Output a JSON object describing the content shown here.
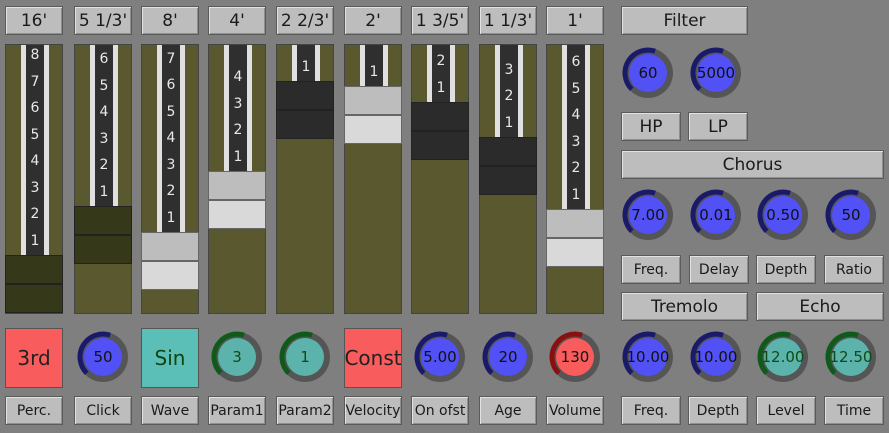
{
  "drawbars": [
    {
      "label": "16'",
      "ticks": [
        "8",
        "7",
        "6",
        "5",
        "4",
        "3",
        "2",
        "1"
      ],
      "handle": "olive",
      "top_seg": "olive"
    },
    {
      "label": "5 1/3'",
      "ticks": [
        "6",
        "5",
        "4",
        "3",
        "2",
        "1"
      ],
      "handle": "olive"
    },
    {
      "label": "8'",
      "ticks": [
        "7",
        "6",
        "5",
        "4",
        "3",
        "2",
        "1"
      ],
      "handle": "light"
    },
    {
      "label": "4'",
      "ticks": [
        "4",
        "3",
        "2",
        "1"
      ],
      "handle": "light"
    },
    {
      "label": "2 2/3'",
      "ticks": [
        "1"
      ],
      "handle": "dark"
    },
    {
      "label": "2'",
      "ticks": [
        "1"
      ],
      "handle": "light"
    },
    {
      "label": "1 3/5'",
      "ticks": [
        "2",
        "1"
      ],
      "handle": "dark"
    },
    {
      "label": "1 1/3'",
      "ticks": [
        "3",
        "2",
        "1"
      ],
      "handle": "dark"
    },
    {
      "label": "1'",
      "ticks": [
        "6",
        "5",
        "4",
        "3",
        "2",
        "1"
      ],
      "handle": "light"
    }
  ],
  "bottom_controls": [
    {
      "type": "button",
      "value": "3rd",
      "color": "#f85c5c",
      "text_color": "#222",
      "label": "Perc."
    },
    {
      "type": "knob",
      "value": "50",
      "color": "#5151f5",
      "ring": "#1a1a6a",
      "label": "Click"
    },
    {
      "type": "button",
      "value": "Sin",
      "color": "#5bbfb8",
      "text_color": "#114411",
      "label": "Wave"
    },
    {
      "type": "knob",
      "value": "3",
      "color": "#5bb3ab",
      "ring": "#0f5a1a",
      "label": "Param1"
    },
    {
      "type": "knob",
      "value": "1",
      "color": "#5bb3ab",
      "ring": "#0f5a1a",
      "label": "Param2"
    },
    {
      "type": "button",
      "value": "Const",
      "color": "#f85c5c",
      "text_color": "#222",
      "label": "Velocity"
    },
    {
      "type": "knob",
      "value": "5.00",
      "color": "#5151f5",
      "ring": "#1a1a6a",
      "label": "On ofst"
    },
    {
      "type": "knob",
      "value": "20",
      "color": "#5151f5",
      "ring": "#1a1a6a",
      "label": "Age"
    },
    {
      "type": "knob",
      "value": "130",
      "color": "#f85c5c",
      "ring": "#8a1010",
      "label": "Volume"
    }
  ],
  "filter": {
    "title": "Filter",
    "knobs": [
      "60",
      "5000"
    ],
    "hp": "HP",
    "lp": "LP"
  },
  "chorus": {
    "title": "Chorus",
    "knobs": [
      "7.00",
      "0.01",
      "0.50",
      "50"
    ],
    "labels": [
      "Freq.",
      "Delay",
      "Depth",
      "Ratio"
    ]
  },
  "tremolo": {
    "title": "Tremolo",
    "knobs": [
      "10.00",
      "10.00"
    ],
    "labels": [
      "Freq.",
      "Depth"
    ]
  },
  "echo": {
    "title": "Echo",
    "knobs": [
      "12.00",
      "12.50"
    ],
    "labels": [
      "Level",
      "Time"
    ]
  },
  "colors": {
    "blue_knob": "#5151f5",
    "teal_knob": "#5bb3ab",
    "red_knob": "#f85c5c",
    "background": "#7f7f7f",
    "olive": "#59582f"
  }
}
